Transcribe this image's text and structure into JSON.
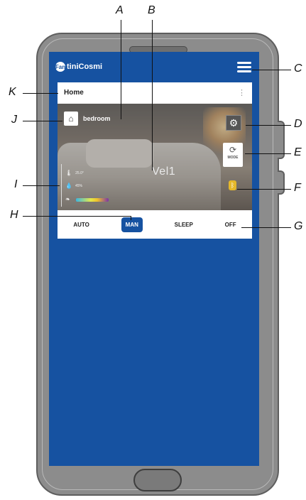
{
  "app": {
    "brand": "FantiniCosmi",
    "brand_badge": "Fan",
    "brand_text": "tiniCosmi"
  },
  "header": {
    "breadcrumb": "Home",
    "more": "⋮"
  },
  "room": {
    "name": "bedroom",
    "speed_label": "Vel1",
    "readouts": [
      {
        "icon": "thermometer-icon",
        "value": "25.0°"
      },
      {
        "icon": "droplet-icon",
        "value": "45%"
      }
    ],
    "air_quality_icon": "leaf-icon",
    "mode_button_label": "MODE"
  },
  "modes": [
    {
      "label": "AUTO",
      "active": false
    },
    {
      "label": "MAN",
      "active": true
    },
    {
      "label": "SLEEP",
      "active": false
    },
    {
      "label": "OFF",
      "active": false
    }
  ],
  "callouts": {
    "A": "A",
    "B": "B",
    "C": "C",
    "D": "D",
    "E": "E",
    "F": "F",
    "G": "G",
    "H": "H",
    "I": "I",
    "J": "J",
    "K": "K"
  },
  "colors": {
    "screen": "#1652a1",
    "phone": "#8c8c8c",
    "active_mode": "#1652a1",
    "bluetooth": "#e5b82b"
  }
}
